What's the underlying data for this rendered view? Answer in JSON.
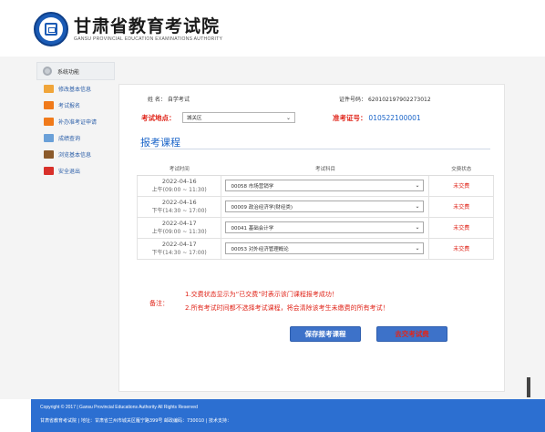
{
  "header": {
    "title": "甘肃省教育考试院",
    "subtitle": "GANSU PROVINCIAL EDUCATION EXAMINATIONS AUTHORITY"
  },
  "sidebar": {
    "title": "系统功能",
    "items": [
      {
        "label": "修改基本信息",
        "icon": "pencil-icon",
        "color": "#f0a53a"
      },
      {
        "label": "考试报名",
        "icon": "register-icon",
        "color": "#f07a1a"
      },
      {
        "label": "补办准考证申请",
        "icon": "card-icon",
        "color": "#f07a1a"
      },
      {
        "label": "成绩查询",
        "icon": "chart-icon",
        "color": "#6aa0d8"
      },
      {
        "label": "浏览基本信息",
        "icon": "book-icon",
        "color": "#8b5a2b"
      },
      {
        "label": "安全退出",
        "icon": "exit-icon",
        "color": "#d8302a"
      }
    ]
  },
  "info": {
    "name_label": "姓 名：",
    "name_value": "自学考试",
    "id_label": "证件号码：",
    "id_value": "620102197902273012",
    "location_label": "考试地点：",
    "location_value": "城关区",
    "ticket_label": "准考证号：",
    "ticket_value": "010522100001"
  },
  "section_title": "报考课程",
  "table": {
    "headers": [
      "考试时间",
      "考试科目",
      "交费状态"
    ],
    "rows": [
      {
        "date": "2022-04-16",
        "time": "上午(09:00 ~ 11:30)",
        "subject": "00058 市场营销学",
        "status": "未交费"
      },
      {
        "date": "2022-04-16",
        "time": "下午(14:30 ~ 17:00)",
        "subject": "00009 政治经济学(财经类)",
        "status": "未交费"
      },
      {
        "date": "2022-04-17",
        "time": "上午(09:00 ~ 11:30)",
        "subject": "00041 基础会计学",
        "status": "未交费"
      },
      {
        "date": "2022-04-17",
        "time": "下午(14:30 ~ 17:00)",
        "subject": "00053 对外经济管理概论",
        "status": "未交费"
      }
    ]
  },
  "notes": {
    "label": "备注：",
    "line1": "1.交费状态显示为“已交费”时表示该门课程报考成功！",
    "line2": "2.所有考试时间都不选择考试课程，将会清除该考生未缴费的所有考试！"
  },
  "buttons": {
    "save": "保存报考课程",
    "pay": "去交考试费"
  },
  "footer": {
    "copyright": "Copyright © 2017 | Gansu Provincial Educations Authority All Rights Reserved",
    "contact": "甘肃省教育考试院 | 地址：甘肃省兰州市城关区雁宁路399号 邮政编码：730010 | 技术支持："
  }
}
